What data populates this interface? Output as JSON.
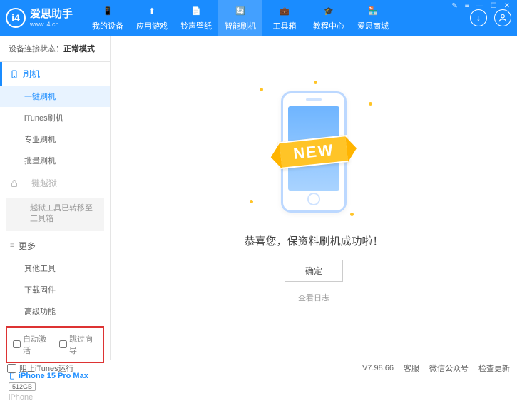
{
  "app": {
    "title": "爱思助手",
    "url": "www.i4.cn"
  },
  "winControls": {
    "skin": "✎",
    "menu": "≡",
    "min": "—",
    "max": "☐",
    "close": "✕"
  },
  "nav": [
    {
      "label": "我的设备",
      "icon": "📱"
    },
    {
      "label": "应用游戏",
      "icon": "⬆"
    },
    {
      "label": "铃声壁纸",
      "icon": "📄"
    },
    {
      "label": "智能刷机",
      "icon": "🔄",
      "active": true
    },
    {
      "label": "工具箱",
      "icon": "💼"
    },
    {
      "label": "教程中心",
      "icon": "🎓"
    },
    {
      "label": "爱思商城",
      "icon": "🏪"
    }
  ],
  "rightIcons": {
    "download": "↓",
    "user": "◯"
  },
  "sidebar": {
    "connLabel": "设备连接状态：",
    "connValue": "正常模式",
    "sec1": {
      "title": "刷机",
      "items": [
        "一键刷机",
        "iTunes刷机",
        "专业刷机",
        "批量刷机"
      ],
      "activeIndex": 0
    },
    "sec2": {
      "title": "一键越狱",
      "note": "越狱工具已转移至工具箱"
    },
    "sec3": {
      "title": "更多",
      "items": [
        "其他工具",
        "下载固件",
        "高级功能"
      ]
    },
    "checks": {
      "autoActivate": "自动激活",
      "skipGuide": "跳过向导"
    },
    "device": {
      "name": "iPhone 15 Pro Max",
      "storage": "512GB",
      "type": "iPhone"
    }
  },
  "main": {
    "ribbon": "NEW",
    "successText": "恭喜您，保资料刷机成功啦！",
    "okBtn": "确定",
    "logLink": "查看日志"
  },
  "footer": {
    "blockItunes": "阻止iTunes运行",
    "version": "V7.98.66",
    "links": [
      "客服",
      "微信公众号",
      "检查更新"
    ]
  }
}
